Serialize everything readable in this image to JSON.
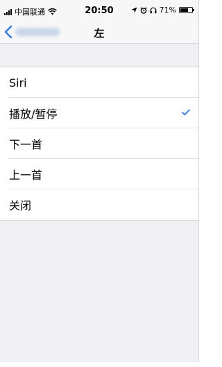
{
  "status": {
    "carrier": "中国联通",
    "time": "20:50",
    "battery": "71%",
    "battery_level": 0.71
  },
  "nav": {
    "title": "左"
  },
  "options": [
    {
      "label": "Siri",
      "selected": false
    },
    {
      "label": "播放/暂停",
      "selected": true
    },
    {
      "label": "下一首",
      "selected": false
    },
    {
      "label": "上一首",
      "selected": false
    },
    {
      "label": "关闭",
      "selected": false
    }
  ],
  "colors": {
    "accent": "#2f7cf6",
    "background": "#efeff4",
    "bar": "#f7f7f7"
  }
}
